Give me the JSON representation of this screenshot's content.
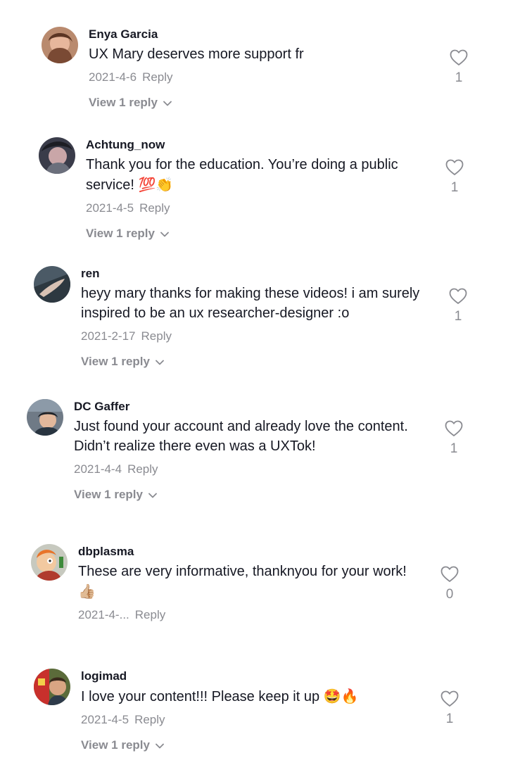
{
  "comments": [
    {
      "username": "Enya Garcia",
      "text": "UX Mary deserves more support fr",
      "date": "2021-4-6",
      "reply_label": "Reply",
      "view_replies": "View 1 reply",
      "likes": "1",
      "emoji": ""
    },
    {
      "username": "Achtung_now",
      "text": "Thank you for the education. You’re doing a public service! ",
      "date": "2021-4-5",
      "reply_label": "Reply",
      "view_replies": "View 1 reply",
      "likes": "1",
      "emoji": "💯👏"
    },
    {
      "username": "ren",
      "text": "heyy mary thanks for making these videos! i am surely inspired to be an ux researcher-designer :o",
      "date": "2021-2-17",
      "reply_label": "Reply",
      "view_replies": "View 1 reply",
      "likes": "1",
      "emoji": ""
    },
    {
      "username": "DC Gaffer",
      "text": "Just found your account and already love the content. Didn’t realize there even was a UXTok!",
      "date": "2021-4-4",
      "reply_label": "Reply",
      "view_replies": "View 1 reply",
      "likes": "1",
      "emoji": ""
    },
    {
      "username": "dbplasma",
      "text": "These are very informative, thanknyou for your work! ",
      "date": "2021-4-...",
      "reply_label": "Reply",
      "view_replies": "",
      "likes": "0",
      "emoji": "👍🏼"
    },
    {
      "username": "logimad",
      "text": "I love your content!!! Please keep it up ",
      "date": "2021-4-5",
      "reply_label": "Reply",
      "view_replies": "View 1 reply",
      "likes": "1",
      "emoji": "🤩🔥"
    }
  ],
  "colors": {
    "text": "#161823",
    "secondary": "#8a8b91",
    "background": "#ffffff"
  },
  "icons": {
    "like": "heart-outline-icon",
    "expand": "chevron-down-icon"
  }
}
